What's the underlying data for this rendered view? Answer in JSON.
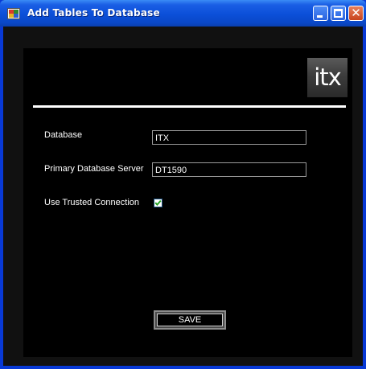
{
  "window": {
    "title": "Add Tables To Database",
    "controls": {
      "minimize_icon": "minimize-icon",
      "maximize_icon": "maximize-icon",
      "close_icon": "close-icon",
      "close_glyph": "✕"
    }
  },
  "logo": {
    "text": "itx"
  },
  "form": {
    "database": {
      "label": "Database",
      "value": "ITX"
    },
    "server": {
      "label": "Primary Database Server",
      "value": "DT1590"
    },
    "trusted": {
      "label": "Use Trusted Connection",
      "checked": true
    },
    "save_label": "SAVE"
  },
  "colors": {
    "titlebar": "#0b4fd8",
    "panel_background": "#000000",
    "text": "#ffffff",
    "checkmark": "#21a121"
  }
}
